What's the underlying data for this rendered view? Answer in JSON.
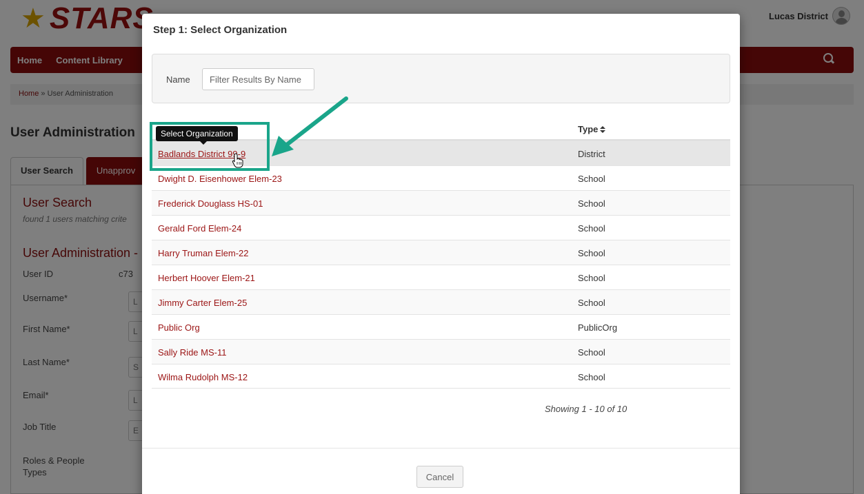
{
  "background": {
    "logo_text": "STARS",
    "user_name": "Lucas District",
    "nav": [
      "Home",
      "Content Library"
    ],
    "breadcrumb": {
      "home": "Home",
      "sep": " » ",
      "current": "User Administration"
    },
    "page_title": "User Administration",
    "tabs": [
      "User Search",
      "Unapprov"
    ],
    "section_user_search": "User Search",
    "found_text": "found 1 users matching crite",
    "section_admin": "User Administration -",
    "fields": [
      {
        "label": "User ID",
        "value": "c73",
        "box": ""
      },
      {
        "label": "Username*",
        "value": "",
        "box": "L"
      },
      {
        "label": "First Name*",
        "value": "",
        "box": "L"
      },
      {
        "label": "Last Name*",
        "value": "",
        "box": "S"
      },
      {
        "label": "Email*",
        "value": "",
        "box": "L"
      },
      {
        "label": "Job Title",
        "value": "",
        "box": "E"
      },
      {
        "label": "Roles & People Types",
        "value": "",
        "box": ""
      }
    ]
  },
  "modal": {
    "title": "Step 1: Select Organization",
    "filter": {
      "label": "Name",
      "placeholder": "Filter Results By Name",
      "value": ""
    },
    "table": {
      "type_header": "Type",
      "rows": [
        {
          "name": "Badlands District 99-9",
          "type": "District"
        },
        {
          "name": "Dwight D. Eisenhower Elem-23",
          "type": "School"
        },
        {
          "name": "Frederick Douglass HS-01",
          "type": "School"
        },
        {
          "name": "Gerald Ford Elem-24",
          "type": "School"
        },
        {
          "name": "Harry Truman Elem-22",
          "type": "School"
        },
        {
          "name": "Herbert Hoover Elem-21",
          "type": "School"
        },
        {
          "name": "Jimmy Carter Elem-25",
          "type": "School"
        },
        {
          "name": "Public Org",
          "type": "PublicOrg"
        },
        {
          "name": "Sally Ride MS-11",
          "type": "School"
        },
        {
          "name": "Wilma Rudolph MS-12",
          "type": "School"
        }
      ]
    },
    "showing": "Showing 1 - 10 of 10",
    "cancel_label": "Cancel"
  },
  "annotation": {
    "tooltip": "Select Organization",
    "highlight_color": "#1aa58a"
  },
  "colors": {
    "brand_red": "#8b0d0d",
    "link_red": "#9b1414"
  }
}
